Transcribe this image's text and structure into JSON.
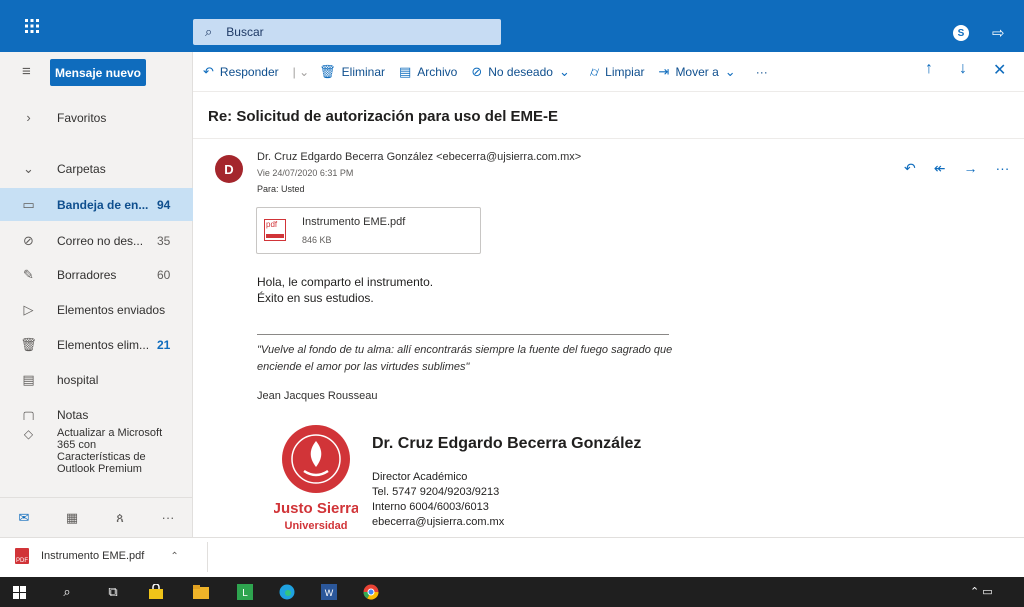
{
  "topbar": {
    "search_placeholder": "Buscar"
  },
  "nav": {
    "new_message": "Mensaje nuevo",
    "favorites": "Favoritos",
    "folders": "Carpetas",
    "items": [
      {
        "label": "Bandeja de en...",
        "count": "94"
      },
      {
        "label": "Correo no des...",
        "count": "35"
      },
      {
        "label": "Borradores",
        "count": "60"
      },
      {
        "label": "Elementos enviados",
        "count": ""
      },
      {
        "label": "Elementos elim...",
        "count": "21"
      },
      {
        "label": "hospital",
        "count": ""
      },
      {
        "label": "Notas",
        "count": ""
      }
    ],
    "upgrade": "Actualizar a Microsoft 365 con Características de Outlook Premium"
  },
  "toolbar": {
    "reply": "Responder",
    "delete": "Eliminar",
    "archive": "Archivo",
    "junk": "No deseado",
    "sweep": "Limpiar",
    "move": "Mover a",
    "more": "···"
  },
  "message": {
    "subject": "Re: Solicitud de autorización para uso del EME-E",
    "avatar_initial": "D",
    "from": "Dr. Cruz Edgardo Becerra González <ebecerra@ujsierra.com.mx>",
    "date": "Vie 24/07/2020 6:31 PM",
    "to": "Para: Usted",
    "attachment": {
      "name": "Instrumento EME.pdf",
      "size": "846 KB",
      "icon_text": "pdf"
    },
    "body_line1": "Hola, le comparto el instrumento.",
    "body_line2": "Éxito en sus estudios.",
    "quote": "\"Vuelve al fondo de tu alma: allí encontrarás siempre la fuente del fuego sagrado que enciende el amor por las virtudes sublimes\"",
    "quote_author": "Jean Jacques Rousseau",
    "signature": {
      "name": "Dr. Cruz Edgardo Becerra González",
      "role": "Director Académico",
      "phone": "Tel. 5747 9204/9203/9213",
      "ext": "Interno 6004/6003/6013",
      "email": "ebecerra@ujsierra.com.mx",
      "logo_top": "Justo Sierra",
      "logo_bottom": "Universidad"
    }
  },
  "download": {
    "file": "Instrumento EME.pdf",
    "icon_text": "PDF"
  },
  "colors": {
    "brand": "#0f6cbd",
    "selected": "#c7e0f4",
    "avatar": "#a4262c",
    "logo_red": "#d13438"
  }
}
